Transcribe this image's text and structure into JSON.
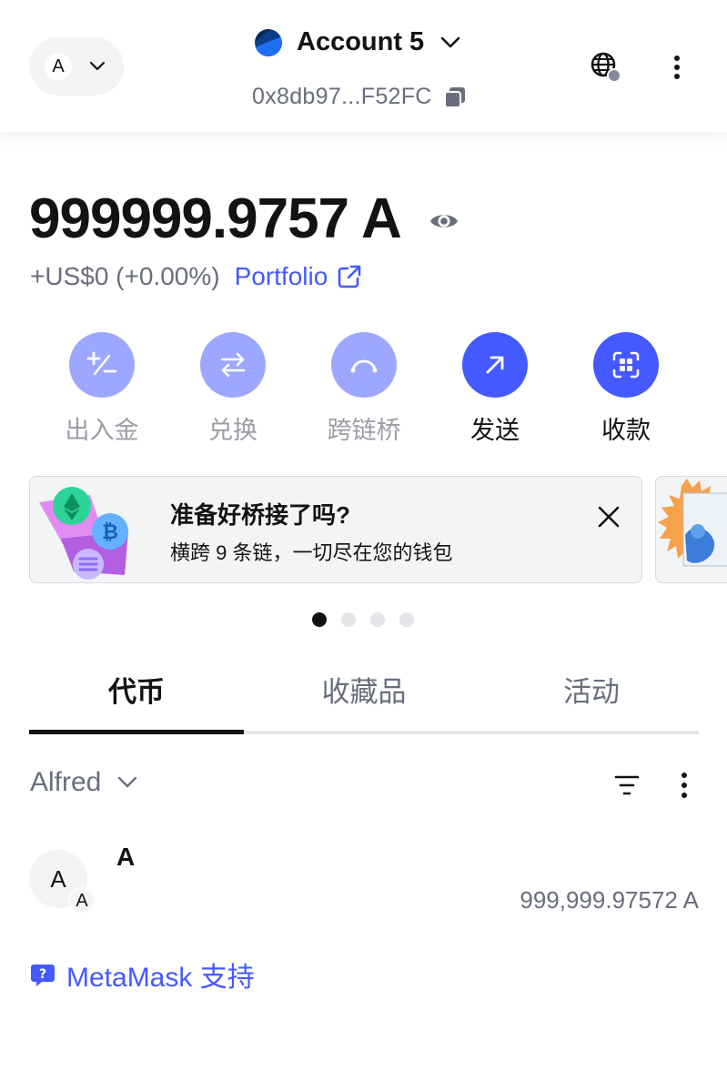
{
  "header": {
    "network_avatar_letter": "A",
    "account_name": "Account 5",
    "account_address": "0x8db97...F52FC"
  },
  "balance": {
    "amount": "999999.9757 A",
    "change": "+US$0 (+0.00%)",
    "portfolio_label": "Portfolio"
  },
  "actions": [
    {
      "label": "出入金",
      "icon": "plus-minus-icon"
    },
    {
      "label": "兑换",
      "icon": "swap-icon"
    },
    {
      "label": "跨链桥",
      "icon": "bridge-icon"
    },
    {
      "label": "发送",
      "icon": "arrow-up-right-icon"
    },
    {
      "label": "收款",
      "icon": "qr-icon"
    }
  ],
  "banner": {
    "title": "准备好桥接了吗?",
    "subtitle": "横跨 9 条链，一切尽在您的钱包"
  },
  "carousel": {
    "total": 4,
    "active": 1
  },
  "tabs": [
    {
      "label": "代币"
    },
    {
      "label": "收藏品"
    },
    {
      "label": "活动"
    }
  ],
  "token_list": {
    "network_filter": "Alfred",
    "tokens": [
      {
        "avatar_letter": "A",
        "badge_letter": "A",
        "name": "A",
        "amount": "999,999.97572 A"
      }
    ]
  },
  "support_label": "MetaMask 支持",
  "colors": {
    "accent": "#4459ff",
    "accent_muted": "#9ea7ff",
    "text_muted": "#686e7d"
  }
}
